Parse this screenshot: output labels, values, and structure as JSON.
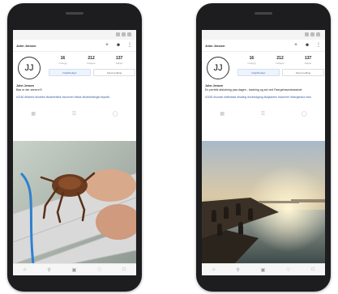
{
  "screens": [
    {
      "username": "John Jensen",
      "avatar_initials": "JJ",
      "stats": [
        {
          "num": "16",
          "label": "Innlegg"
        },
        {
          "num": "212",
          "label": "Følgere"
        },
        {
          "num": "137",
          "label": "Følger"
        }
      ],
      "edit_label": "Følg/Rediger",
      "secondary_label": "Send melding",
      "bio_name": "John Jensen",
      "bio_text": "Bas er der senere!!!",
      "hashtags": "#2180 #fiskeliv #krabbe #krabbefiske #sommer #fiske #krabbefangst #kystliv",
      "icons": {
        "top": [
          "plus-icon",
          "person-icon",
          "more-icon"
        ],
        "tabs": [
          "grid-icon",
          "list-icon",
          "tag-icon"
        ]
      }
    },
    {
      "username": "John Jensen",
      "avatar_initials": "JJ",
      "stats": [
        {
          "num": "16",
          "label": "Innlegg"
        },
        {
          "num": "212",
          "label": "Følgere"
        },
        {
          "num": "137",
          "label": "Følger"
        }
      ],
      "edit_label": "Følg/Rediger",
      "secondary_label": "Send melding",
      "bio_name": "John Jensen",
      "bio_text": "En perfekt afslutning paa dagen - badning og sol ved Faergehavnsbassinet",
      "hashtags": "#2180 #sunset #aftenbad #bading #solnedgang #kajkanten #sommer #faergehavn #sol",
      "icons": {
        "top": [
          "plus-icon",
          "person-icon",
          "more-icon"
        ],
        "tabs": [
          "grid-icon",
          "list-icon",
          "tag-icon"
        ]
      }
    }
  ]
}
